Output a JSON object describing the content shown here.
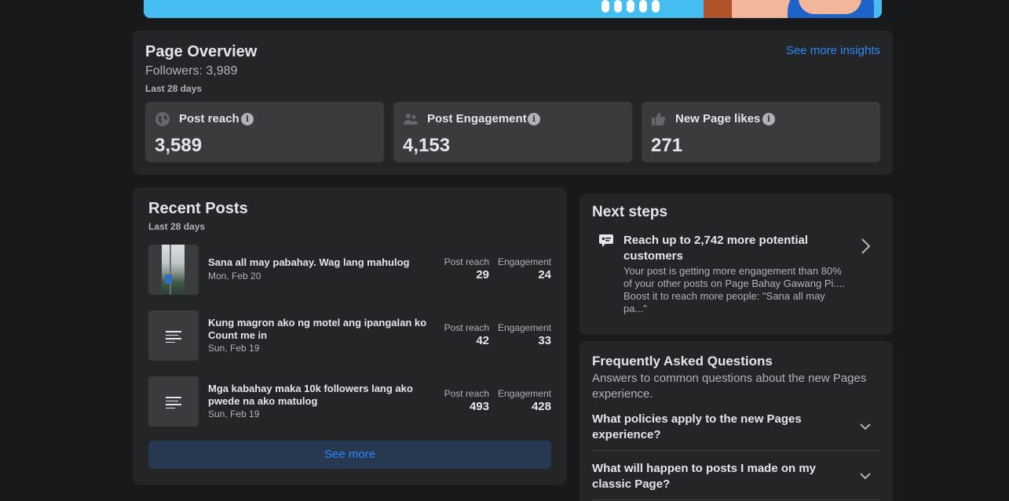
{
  "overview": {
    "title": "Page Overview",
    "followers": "Followers: 3,989",
    "range": "Last 28 days",
    "insights_link": "See more insights",
    "metrics": [
      {
        "label": "Post reach",
        "value": "3,589",
        "icon": "globe-icon"
      },
      {
        "label": "Post Engagement",
        "value": "4,153",
        "icon": "people-icon"
      },
      {
        "label": "New Page likes",
        "value": "271",
        "icon": "thumbs-up-icon"
      }
    ],
    "info_glyph": "i"
  },
  "recent": {
    "title": "Recent Posts",
    "range": "Last 28 days",
    "reach_label": "Post reach",
    "engagement_label": "Engagement",
    "posts": [
      {
        "title": "Sana all may pabahay. Wag lang mahulog",
        "date": "Mon, Feb 20",
        "reach": "29",
        "engagement": "24",
        "thumb": "photo"
      },
      {
        "title": "Kung magron ako ng motel ang ipangalan ko Count me in",
        "date": "Sun, Feb 19",
        "reach": "42",
        "engagement": "33",
        "thumb": "text-post-icon"
      },
      {
        "title": "Mga kabahay maka 10k followers lang ako pwede na ako matulog",
        "date": "Sun, Feb 19",
        "reach": "493",
        "engagement": "428",
        "thumb": "text-post-icon"
      }
    ],
    "see_more": "See more"
  },
  "next_steps": {
    "title": "Next steps",
    "item_title": "Reach up to 2,742 more potential customers",
    "item_desc": "Your post is getting more engagement than 80% of your other posts on Page Bahay Gawang Pi.... Boost it to reach more people: \"Sana all may pa...\"",
    "icon": "chat-bubble-icon"
  },
  "faq": {
    "title": "Frequently Asked Questions",
    "subtitle": "Answers to common questions about the new Pages experience.",
    "questions": [
      "What policies apply to the new Pages experience?",
      "What will happen to posts I made on my classic Page?"
    ]
  },
  "colors": {
    "background": "#18191a",
    "card": "#242526",
    "accent": "#2d88ff",
    "banner": "#45bdf0"
  }
}
